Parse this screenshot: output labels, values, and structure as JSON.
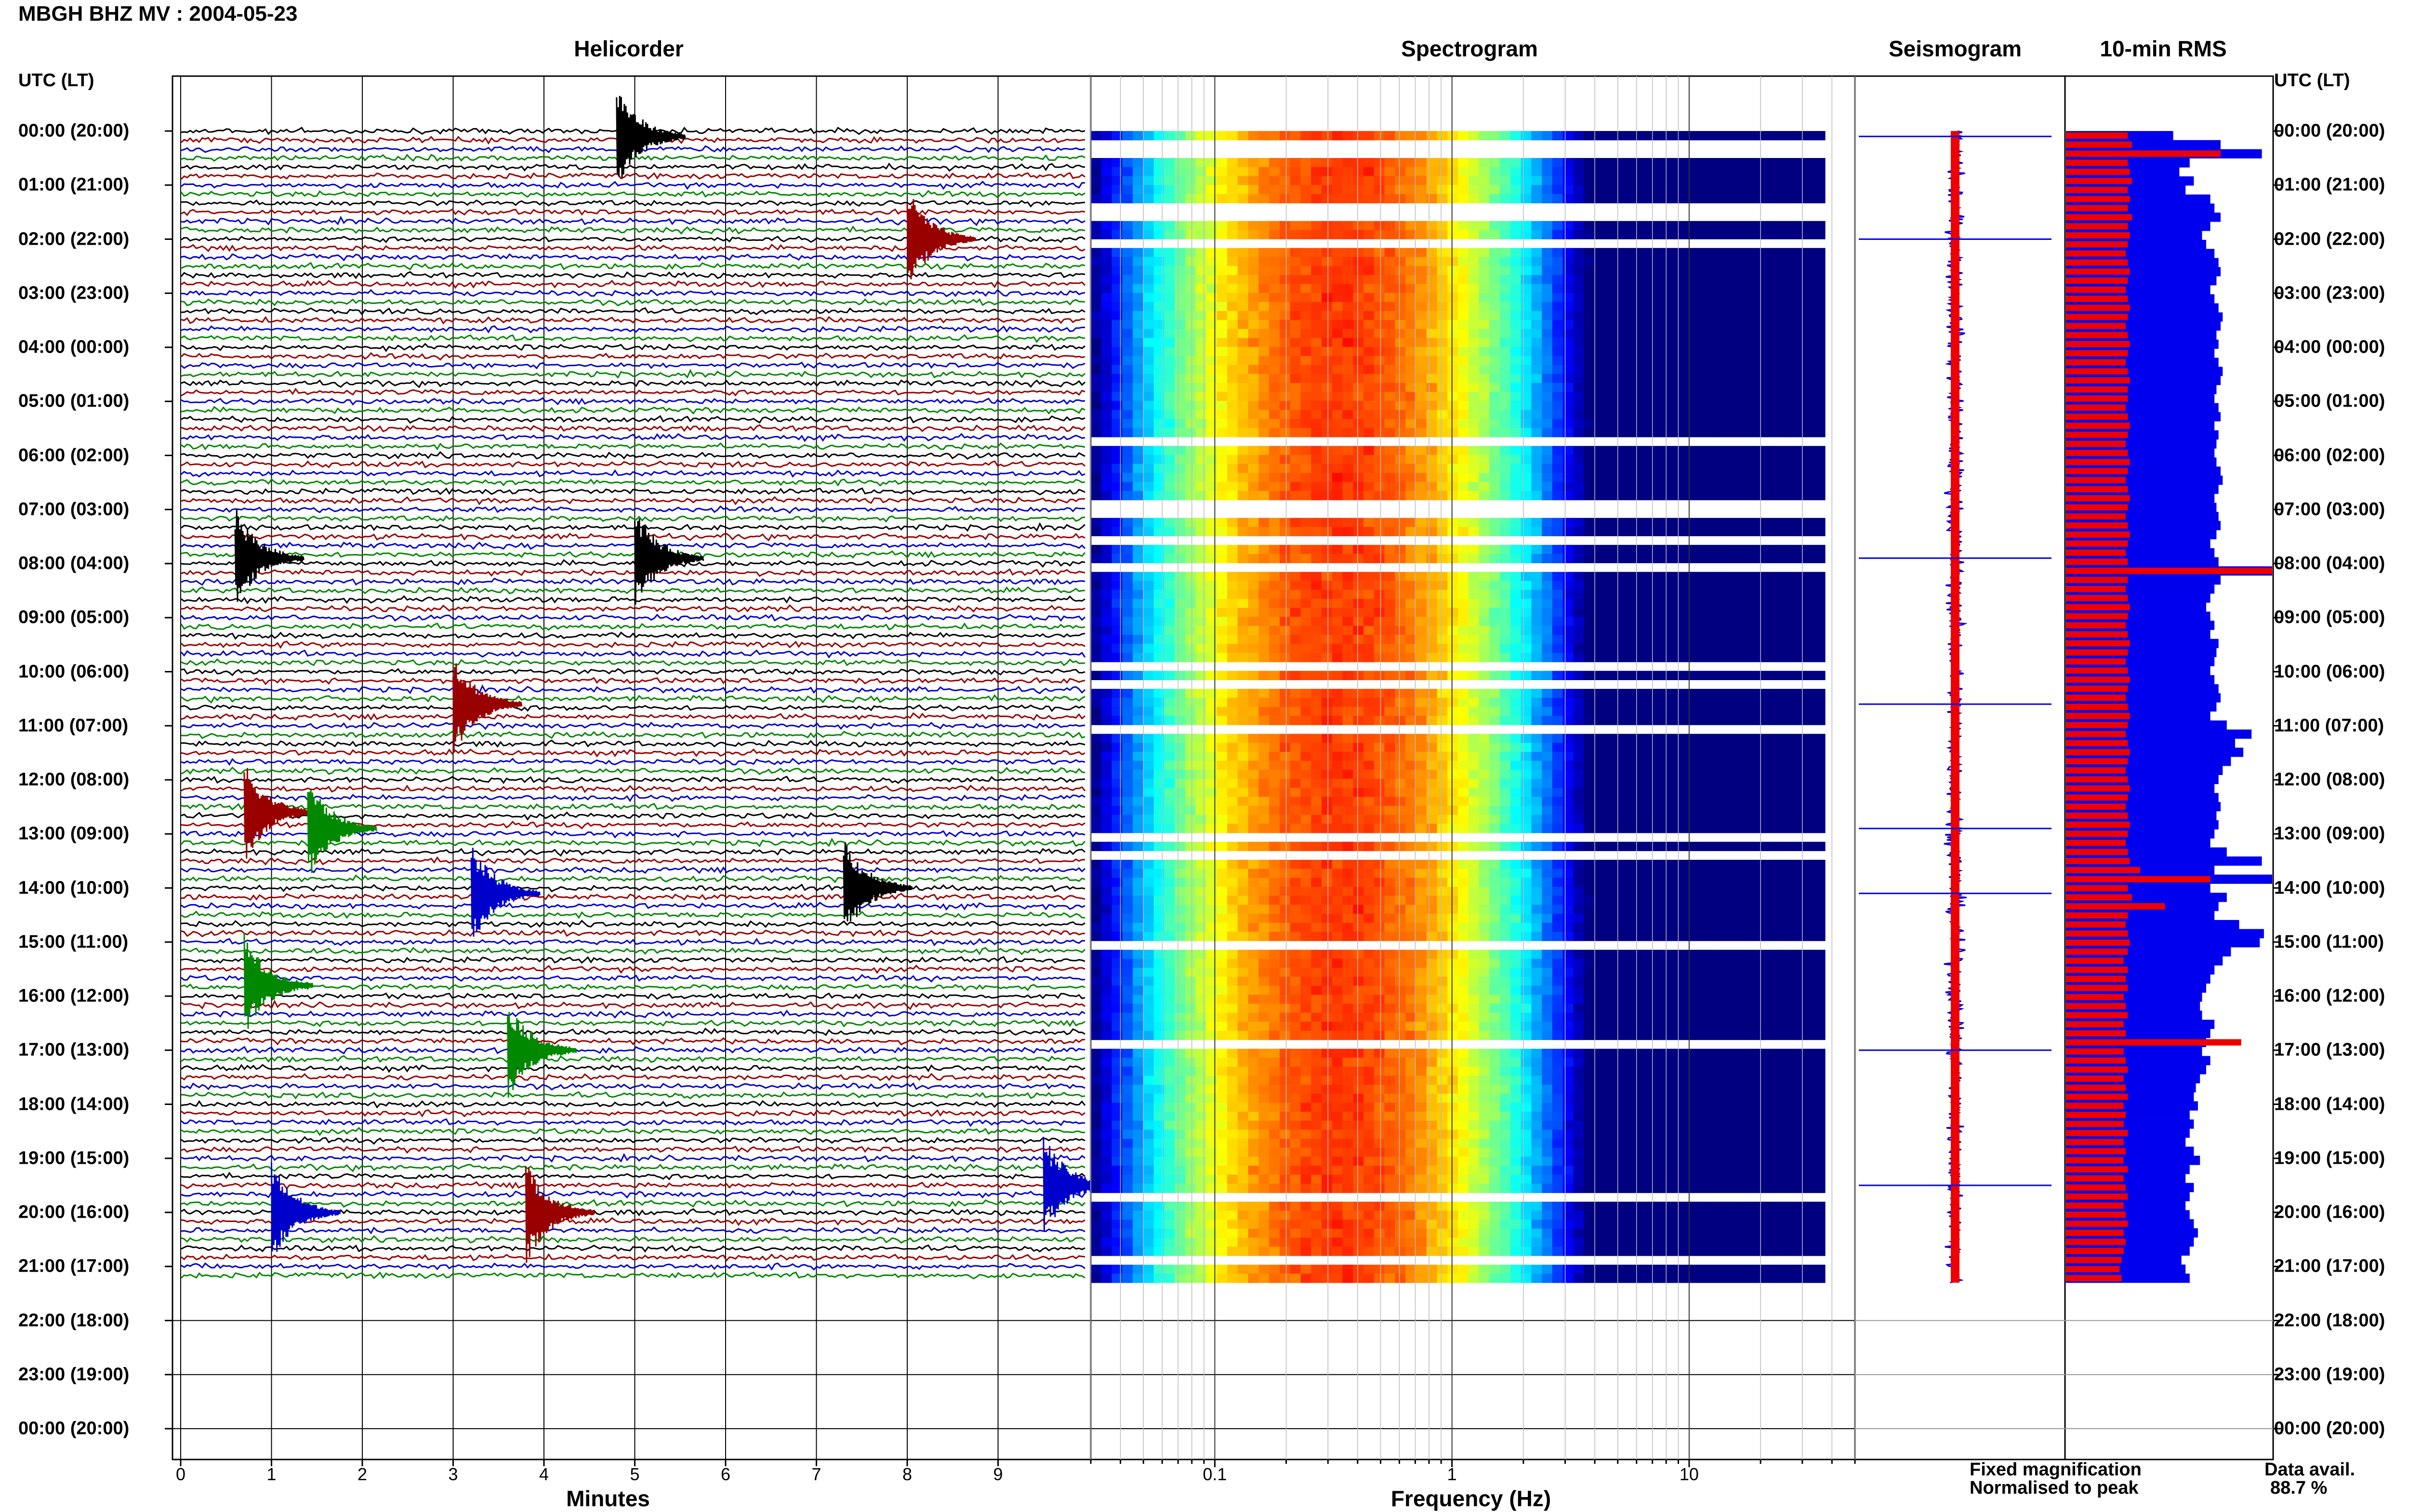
{
  "page": {
    "title": "MBGH BHZ MV : 2004-05-23",
    "utc_header_left": "UTC (LT)",
    "utc_header_right": "UTC (LT)"
  },
  "panels": {
    "helicorder": "Helicorder",
    "spectrogram": "Spectrogram",
    "seismogram": "Seismogram",
    "rms": "10-min RMS"
  },
  "axes": {
    "helicorder_xlabel": "Minutes",
    "spectrogram_xlabel": "Frequency (Hz)"
  },
  "legend": {
    "fixed": "Fixed magnification",
    "normalised": "Normalised to peak",
    "fixed_color": "#0000ee",
    "normalised_color": "#ee0000"
  },
  "data_avail": {
    "label": "Data avail.",
    "value": "88.7 %"
  },
  "chart_data": [
    {
      "type": "line",
      "panel": "Helicorder",
      "xlabel": "Minutes",
      "x_ticks": [
        "0",
        "1",
        "2",
        "3",
        "4",
        "5",
        "6",
        "7",
        "8",
        "9"
      ],
      "xlim": [
        0,
        10
      ],
      "y_ticks": [
        "00:00 (20:00)",
        "01:00 (21:00)",
        "02:00 (22:00)",
        "03:00 (23:00)",
        "04:00 (00:00)",
        "05:00 (01:00)",
        "06:00 (02:00)",
        "07:00 (03:00)",
        "08:00 (04:00)",
        "09:00 (05:00)",
        "10:00 (06:00)",
        "11:00 (07:00)",
        "12:00 (08:00)",
        "13:00 (09:00)",
        "14:00 (10:00)",
        "15:00 (11:00)",
        "16:00 (12:00)",
        "17:00 (13:00)",
        "18:00 (14:00)",
        "19:00 (15:00)",
        "20:00 (16:00)",
        "21:00 (17:00)",
        "22:00 (18:00)",
        "23:00 (19:00)",
        "00:00 (20:00)"
      ],
      "trace_colors": [
        "#000000",
        "#990000",
        "#0000cc",
        "#008800"
      ],
      "events": [
        {
          "hour": 0.1,
          "minute": 4.8,
          "color": "#000000"
        },
        {
          "hour": 2.0,
          "minute": 8.0,
          "color": "#990000"
        },
        {
          "hour": 7.9,
          "minute": 0.6,
          "color": "#000000"
        },
        {
          "hour": 7.9,
          "minute": 5.0,
          "color": "#000000"
        },
        {
          "hour": 10.6,
          "minute": 3.0,
          "color": "#990000"
        },
        {
          "hour": 12.6,
          "minute": 0.7,
          "color": "#990000"
        },
        {
          "hour": 12.9,
          "minute": 1.4,
          "color": "#008800"
        },
        {
          "hour": 14.1,
          "minute": 3.2,
          "color": "#0000cc"
        },
        {
          "hour": 14.0,
          "minute": 7.3,
          "color": "#000000"
        },
        {
          "hour": 15.8,
          "minute": 0.7,
          "color": "#008800"
        },
        {
          "hour": 17.0,
          "minute": 3.6,
          "color": "#008800"
        },
        {
          "hour": 19.5,
          "minute": 9.5,
          "color": "#0000cc"
        },
        {
          "hour": 20.0,
          "minute": 1.0,
          "color": "#0000cc"
        },
        {
          "hour": 20.0,
          "minute": 3.8,
          "color": "#990000"
        }
      ]
    },
    {
      "type": "heatmap",
      "panel": "Spectrogram",
      "xlabel": "Frequency (Hz)",
      "x_scale": "log",
      "xlim": [
        0.03,
        50
      ],
      "x_ticks": [
        "0.1",
        "1",
        "10"
      ],
      "colormap": "jet",
      "peak_band_hz": [
        0.25,
        0.45
      ]
    },
    {
      "type": "bar",
      "panel": "10-min RMS",
      "orientation": "horizontal",
      "series": [
        {
          "name": "Fixed magnification",
          "color": "#0000ee",
          "values": [
            0.52,
            0.75,
            0.95,
            0.6,
            0.55,
            0.62,
            0.58,
            0.7,
            0.72,
            0.75,
            0.7,
            0.66,
            0.68,
            0.72,
            0.74,
            0.75,
            0.73,
            0.7,
            0.72,
            0.74,
            0.76,
            0.75,
            0.73,
            0.74,
            0.72,
            0.74,
            0.76,
            0.75,
            0.73,
            0.72,
            0.74,
            0.75,
            0.72,
            0.74,
            0.73,
            0.72,
            0.73,
            0.75,
            0.76,
            0.74,
            0.72,
            0.73,
            0.74,
            0.75,
            0.73,
            0.7,
            0.72,
            0.74,
            1.0,
            0.75,
            0.72,
            0.7,
            0.68,
            0.7,
            0.72,
            0.7,
            0.74,
            0.73,
            0.72,
            0.7,
            0.72,
            0.74,
            0.75,
            0.73,
            0.7,
            0.78,
            0.9,
            0.82,
            0.86,
            0.8,
            0.76,
            0.74,
            0.72,
            0.74,
            0.75,
            0.73,
            0.74,
            0.72,
            0.7,
            0.78,
            0.95,
            0.72,
            1.0,
            0.7,
            0.78,
            0.74,
            0.72,
            0.84,
            0.96,
            0.94,
            0.8,
            0.76,
            0.72,
            0.7,
            0.68,
            0.66,
            0.65,
            0.66,
            0.72,
            0.7,
            0.68,
            0.66,
            0.7,
            0.68,
            0.65,
            0.63,
            0.62,
            0.64,
            0.6,
            0.62,
            0.6,
            0.58,
            0.62,
            0.65,
            0.6,
            0.58,
            0.62,
            0.6,
            0.58,
            0.6,
            0.62,
            0.64,
            0.62,
            0.6,
            0.56,
            0.58,
            0.6
          ]
        },
        {
          "name": "Normalised to peak",
          "color": "#ee0000",
          "values": [
            0.3,
            0.32,
            0.75,
            0.3,
            0.31,
            0.32,
            0.3,
            0.31,
            0.3,
            0.32,
            0.3,
            0.31,
            0.3,
            0.29,
            0.3,
            0.31,
            0.3,
            0.29,
            0.3,
            0.31,
            0.3,
            0.29,
            0.3,
            0.31,
            0.3,
            0.29,
            0.3,
            0.31,
            0.3,
            0.3,
            0.29,
            0.3,
            0.31,
            0.3,
            0.29,
            0.3,
            0.31,
            0.3,
            0.29,
            0.3,
            0.31,
            0.3,
            0.29,
            0.3,
            0.31,
            0.3,
            0.29,
            0.3,
            1.0,
            0.3,
            0.29,
            0.3,
            0.31,
            0.3,
            0.29,
            0.3,
            0.31,
            0.3,
            0.29,
            0.3,
            0.31,
            0.3,
            0.29,
            0.3,
            0.31,
            0.3,
            0.29,
            0.3,
            0.31,
            0.3,
            0.29,
            0.3,
            0.31,
            0.3,
            0.29,
            0.3,
            0.31,
            0.3,
            0.29,
            0.3,
            0.31,
            0.36,
            0.7,
            0.3,
            0.32,
            0.48,
            0.3,
            0.29,
            0.3,
            0.31,
            0.3,
            0.28,
            0.3,
            0.29,
            0.3,
            0.28,
            0.29,
            0.3,
            0.28,
            0.29,
            0.85,
            0.28,
            0.29,
            0.3,
            0.28,
            0.29,
            0.3,
            0.28,
            0.29,
            0.28,
            0.3,
            0.28,
            0.29,
            0.28,
            0.3,
            0.28,
            0.29,
            0.3,
            0.28,
            0.29,
            0.3,
            0.28,
            0.29,
            0.28,
            0.27,
            0.26,
            0.27
          ]
        }
      ]
    }
  ]
}
